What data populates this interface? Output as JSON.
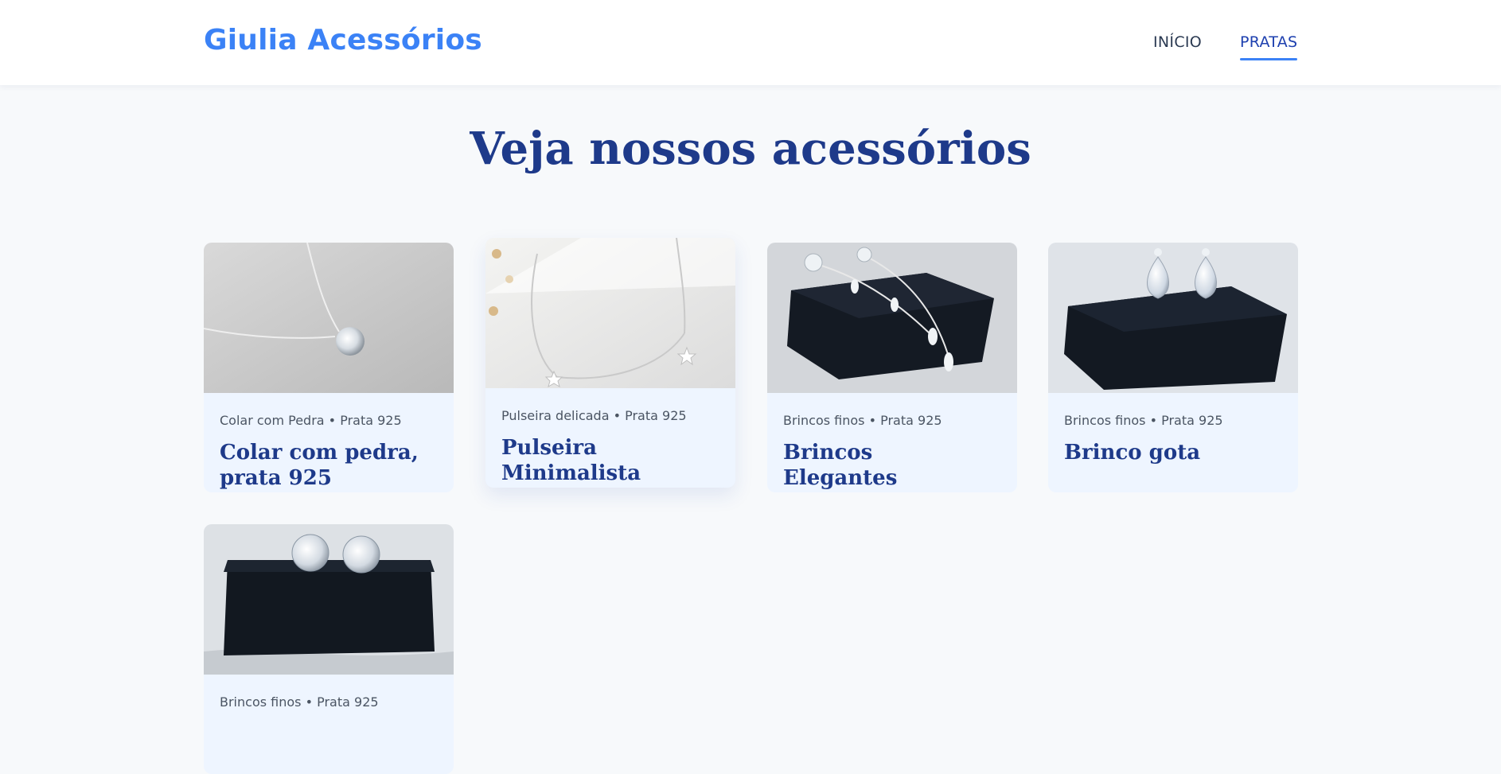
{
  "header": {
    "logo": "Giulia Acessórios",
    "nav": [
      {
        "label": "INÍCIO",
        "active": false
      },
      {
        "label": "PRATAS",
        "active": true
      }
    ]
  },
  "main": {
    "title": "Veja nossos acessórios",
    "products": [
      {
        "meta": "Colar com Pedra • Prata 925",
        "title": "Colar com pedra, prata 925",
        "image": "silver-necklace-with-stone"
      },
      {
        "meta": "Pulseira delicada • Prata 925",
        "title": "Pulseira Minimalista",
        "image": "silver-bracelet-with-stars"
      },
      {
        "meta": "Brincos finos • Prata 925",
        "title": "Brincos Elegantes",
        "image": "long-drop-earrings-on-black-box"
      },
      {
        "meta": "Brincos finos • Prata 925",
        "title": "Brinco gota",
        "image": "teardrop-earrings-on-black-box"
      },
      {
        "meta": "Brincos finos • Prata 925",
        "title": "",
        "image": "round-stud-earrings-on-black-box"
      }
    ]
  },
  "colors": {
    "brand": "#3b82f6",
    "heading": "#1e3a8a",
    "card_background": "#eef5ff",
    "page_background": "#f7f9fb"
  }
}
